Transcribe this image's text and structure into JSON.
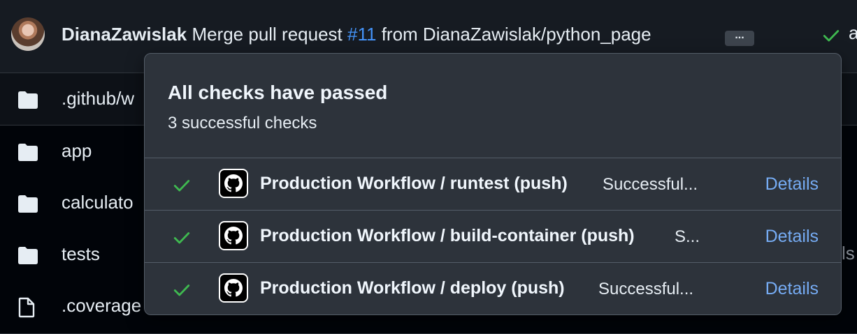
{
  "commit": {
    "author": "DianaZawislak",
    "message_prefix": "Merge pull request",
    "pr_link": "#11",
    "message_suffix": "from DianaZawislak/python_page",
    "ellipsis": "...",
    "status_icon": "check-icon",
    "trailing_text": "a"
  },
  "files": [
    {
      "name": ".github/w",
      "icon": "folder-icon"
    },
    {
      "name": "app",
      "icon": "folder-icon"
    },
    {
      "name": "calculato",
      "icon": "folder-icon"
    },
    {
      "name": "tests",
      "icon": "folder-icon",
      "right_text": "ls"
    },
    {
      "name": ".coverage",
      "icon": "file-icon"
    }
  ],
  "checks_popover": {
    "title": "All checks have passed",
    "subtitle": "3 successful checks",
    "checks": [
      {
        "name": "Production Workflow / runtest (push)",
        "status": "Successful...",
        "link": "Details"
      },
      {
        "name": "Production Workflow / build-container (push)",
        "status": "S...",
        "link": "Details"
      },
      {
        "name": "Production Workflow / deploy (push)",
        "status": "Successful...",
        "link": "Details"
      }
    ]
  },
  "colors": {
    "success": "#3fb950",
    "link": "#4493f8",
    "popover_bg": "#2d333b",
    "page_bg": "#0d1117"
  }
}
